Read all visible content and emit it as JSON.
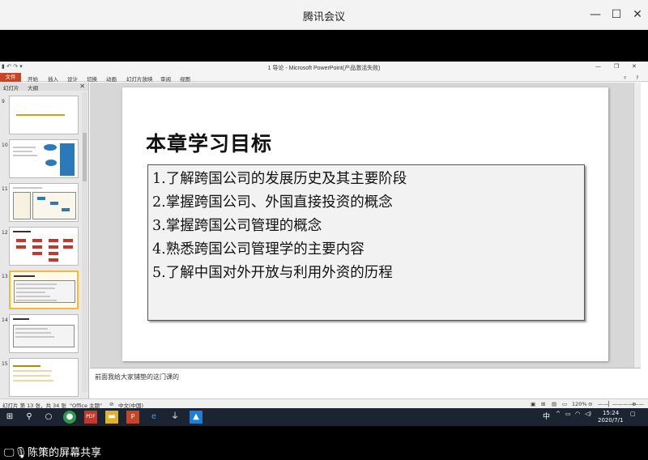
{
  "meeting": {
    "title": "腾讯会议",
    "min": "—",
    "max": "☐",
    "close": "✕",
    "share_label": "陈策的屏幕共享"
  },
  "ppt": {
    "title": "1 导论 - Microsoft PowerPoint(产品激活失败)",
    "quick_access": "▮ ↶ ↷ ▾",
    "tabs": [
      "文件",
      "开始",
      "插入",
      "设计",
      "切换",
      "动画",
      "幻灯片放映",
      "审阅",
      "视图"
    ],
    "panel_tabs": [
      "幻灯片",
      "大纲"
    ],
    "panel_close": "✕",
    "thumb_numbers": [
      "9",
      "10",
      "11",
      "12",
      "13",
      "14",
      "15"
    ],
    "slide_title": "本章学习目标",
    "objectives": [
      "1.了解跨国公司的发展历史及其主要阶段",
      "2.掌握跨国公司、外国直接投资的概念",
      "3.掌握跨国公司管理的概念",
      "4.熟悉跨国公司管理学的主要内容",
      "5.了解中国对外开放与利用外资的历程"
    ],
    "notes": "前面我给大家铺垫的这门课的",
    "status": {
      "slide_info": "幻灯片 第 13 张，共 34 张",
      "theme": "\"Office 主题\"",
      "lang": "中文(中国)",
      "zoom": "120%"
    }
  },
  "taskbar": {
    "time": "15:24",
    "date": "2020/7/1",
    "ime": "中"
  },
  "colors": {
    "ppt_accent": "#c4452a",
    "selection": "#f3b93a",
    "taskbar": "#1b2430"
  }
}
